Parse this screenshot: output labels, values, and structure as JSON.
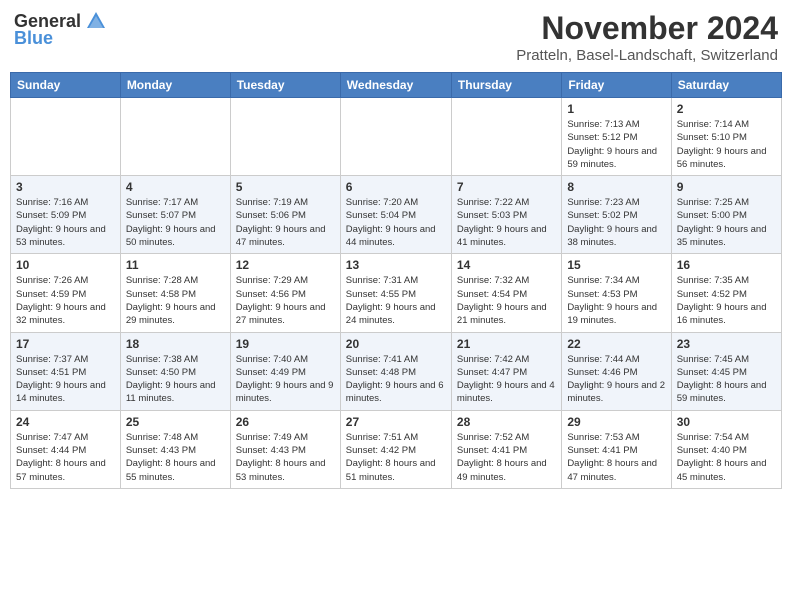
{
  "header": {
    "logo_general": "General",
    "logo_blue": "Blue",
    "month_title": "November 2024",
    "location": "Pratteln, Basel-Landschaft, Switzerland"
  },
  "days_of_week": [
    "Sunday",
    "Monday",
    "Tuesday",
    "Wednesday",
    "Thursday",
    "Friday",
    "Saturday"
  ],
  "weeks": [
    [
      {
        "day": "",
        "info": ""
      },
      {
        "day": "",
        "info": ""
      },
      {
        "day": "",
        "info": ""
      },
      {
        "day": "",
        "info": ""
      },
      {
        "day": "",
        "info": ""
      },
      {
        "day": "1",
        "info": "Sunrise: 7:13 AM\nSunset: 5:12 PM\nDaylight: 9 hours and 59 minutes."
      },
      {
        "day": "2",
        "info": "Sunrise: 7:14 AM\nSunset: 5:10 PM\nDaylight: 9 hours and 56 minutes."
      }
    ],
    [
      {
        "day": "3",
        "info": "Sunrise: 7:16 AM\nSunset: 5:09 PM\nDaylight: 9 hours and 53 minutes."
      },
      {
        "day": "4",
        "info": "Sunrise: 7:17 AM\nSunset: 5:07 PM\nDaylight: 9 hours and 50 minutes."
      },
      {
        "day": "5",
        "info": "Sunrise: 7:19 AM\nSunset: 5:06 PM\nDaylight: 9 hours and 47 minutes."
      },
      {
        "day": "6",
        "info": "Sunrise: 7:20 AM\nSunset: 5:04 PM\nDaylight: 9 hours and 44 minutes."
      },
      {
        "day": "7",
        "info": "Sunrise: 7:22 AM\nSunset: 5:03 PM\nDaylight: 9 hours and 41 minutes."
      },
      {
        "day": "8",
        "info": "Sunrise: 7:23 AM\nSunset: 5:02 PM\nDaylight: 9 hours and 38 minutes."
      },
      {
        "day": "9",
        "info": "Sunrise: 7:25 AM\nSunset: 5:00 PM\nDaylight: 9 hours and 35 minutes."
      }
    ],
    [
      {
        "day": "10",
        "info": "Sunrise: 7:26 AM\nSunset: 4:59 PM\nDaylight: 9 hours and 32 minutes."
      },
      {
        "day": "11",
        "info": "Sunrise: 7:28 AM\nSunset: 4:58 PM\nDaylight: 9 hours and 29 minutes."
      },
      {
        "day": "12",
        "info": "Sunrise: 7:29 AM\nSunset: 4:56 PM\nDaylight: 9 hours and 27 minutes."
      },
      {
        "day": "13",
        "info": "Sunrise: 7:31 AM\nSunset: 4:55 PM\nDaylight: 9 hours and 24 minutes."
      },
      {
        "day": "14",
        "info": "Sunrise: 7:32 AM\nSunset: 4:54 PM\nDaylight: 9 hours and 21 minutes."
      },
      {
        "day": "15",
        "info": "Sunrise: 7:34 AM\nSunset: 4:53 PM\nDaylight: 9 hours and 19 minutes."
      },
      {
        "day": "16",
        "info": "Sunrise: 7:35 AM\nSunset: 4:52 PM\nDaylight: 9 hours and 16 minutes."
      }
    ],
    [
      {
        "day": "17",
        "info": "Sunrise: 7:37 AM\nSunset: 4:51 PM\nDaylight: 9 hours and 14 minutes."
      },
      {
        "day": "18",
        "info": "Sunrise: 7:38 AM\nSunset: 4:50 PM\nDaylight: 9 hours and 11 minutes."
      },
      {
        "day": "19",
        "info": "Sunrise: 7:40 AM\nSunset: 4:49 PM\nDaylight: 9 hours and 9 minutes."
      },
      {
        "day": "20",
        "info": "Sunrise: 7:41 AM\nSunset: 4:48 PM\nDaylight: 9 hours and 6 minutes."
      },
      {
        "day": "21",
        "info": "Sunrise: 7:42 AM\nSunset: 4:47 PM\nDaylight: 9 hours and 4 minutes."
      },
      {
        "day": "22",
        "info": "Sunrise: 7:44 AM\nSunset: 4:46 PM\nDaylight: 9 hours and 2 minutes."
      },
      {
        "day": "23",
        "info": "Sunrise: 7:45 AM\nSunset: 4:45 PM\nDaylight: 8 hours and 59 minutes."
      }
    ],
    [
      {
        "day": "24",
        "info": "Sunrise: 7:47 AM\nSunset: 4:44 PM\nDaylight: 8 hours and 57 minutes."
      },
      {
        "day": "25",
        "info": "Sunrise: 7:48 AM\nSunset: 4:43 PM\nDaylight: 8 hours and 55 minutes."
      },
      {
        "day": "26",
        "info": "Sunrise: 7:49 AM\nSunset: 4:43 PM\nDaylight: 8 hours and 53 minutes."
      },
      {
        "day": "27",
        "info": "Sunrise: 7:51 AM\nSunset: 4:42 PM\nDaylight: 8 hours and 51 minutes."
      },
      {
        "day": "28",
        "info": "Sunrise: 7:52 AM\nSunset: 4:41 PM\nDaylight: 8 hours and 49 minutes."
      },
      {
        "day": "29",
        "info": "Sunrise: 7:53 AM\nSunset: 4:41 PM\nDaylight: 8 hours and 47 minutes."
      },
      {
        "day": "30",
        "info": "Sunrise: 7:54 AM\nSunset: 4:40 PM\nDaylight: 8 hours and 45 minutes."
      }
    ]
  ]
}
